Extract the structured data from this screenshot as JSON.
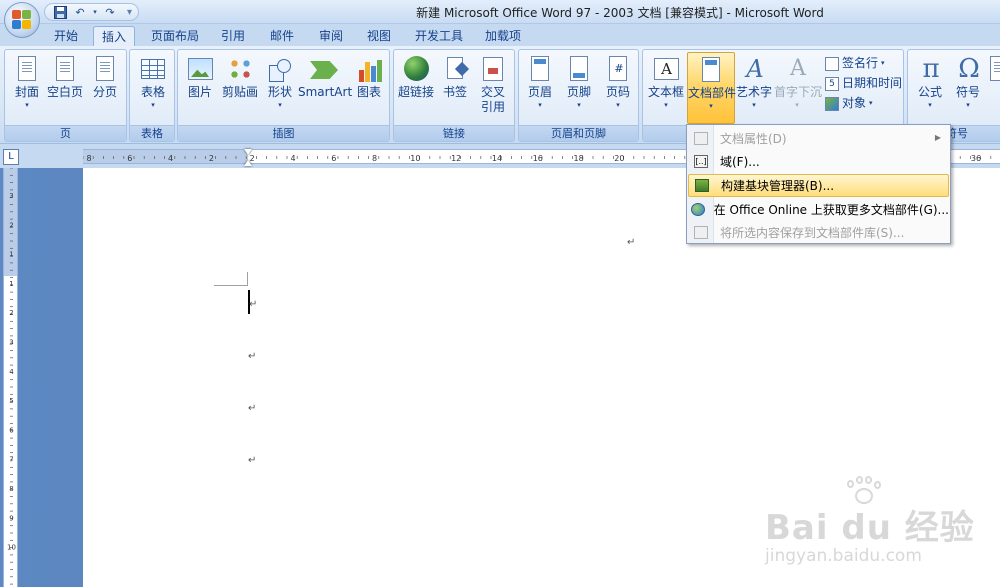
{
  "window": {
    "title": "新建 Microsoft Office Word 97 - 2003 文档 [兼容模式] - Microsoft Word"
  },
  "quick_access": {
    "save_icon": "save-icon",
    "undo_icon": "undo-icon",
    "redo_icon": "redo-icon"
  },
  "tabs": [
    "开始",
    "插入",
    "页面布局",
    "引用",
    "邮件",
    "审阅",
    "视图",
    "开发工具",
    "加载项"
  ],
  "active_tab": "插入",
  "ribbon": {
    "groups": {
      "pages": {
        "label": "页",
        "buttons": [
          "封面",
          "空白页",
          "分页"
        ]
      },
      "tables": {
        "label": "表格",
        "buttons": [
          "表格"
        ]
      },
      "illustrations": {
        "label": "插图",
        "buttons": [
          "图片",
          "剪贴画",
          "形状",
          "SmartArt",
          "图表"
        ]
      },
      "links": {
        "label": "链接",
        "buttons": [
          "超链接",
          "书签",
          "交叉",
          "引用"
        ]
      },
      "header_footer": {
        "label": "页眉和页脚",
        "buttons": [
          "页眉",
          "页脚",
          "页码"
        ]
      },
      "text": {
        "label": "",
        "buttons": [
          "文本框",
          "文档部件",
          "艺术字",
          "首字下沉"
        ],
        "small": [
          "签名行",
          "日期和时间",
          "对象"
        ]
      },
      "symbols": {
        "label": "符号",
        "buttons": [
          "公式",
          "符号"
        ]
      }
    }
  },
  "ruler": {
    "horizontal_labels": [
      "8",
      "6",
      "4",
      "2",
      "2",
      "4",
      "6",
      "8",
      "10",
      "12",
      "14",
      "16",
      "18",
      "20",
      "36"
    ],
    "vertical_labels": [
      "3",
      "2",
      "1",
      "1",
      "2",
      "3",
      "4",
      "5",
      "6",
      "7",
      "8",
      "9",
      "10"
    ]
  },
  "quick_parts_menu": {
    "items": [
      {
        "label": "文档属性(D)",
        "enabled": false,
        "submenu": true,
        "icon": "document-property-icon"
      },
      {
        "label": "域(F)...",
        "enabled": true,
        "submenu": false,
        "icon": "field-icon"
      },
      {
        "label": "构建基块管理器(B)...",
        "enabled": true,
        "submenu": false,
        "highlighted": true,
        "icon": "building-blocks-icon"
      },
      {
        "label": "在 Office Online 上获取更多文档部件(G)...",
        "enabled": true,
        "submenu": false,
        "icon": "office-online-icon"
      },
      {
        "label": "将所选内容保存到文档部件库(S)...",
        "enabled": false,
        "submenu": false,
        "icon": "save-to-gallery-icon"
      }
    ]
  },
  "watermark": {
    "main": "Bai du 经验",
    "sub": "jingyan.baidu.com"
  },
  "colors": {
    "accent": "#15428b",
    "highlight": "#ffd76b",
    "doc_background": "#4d79b6"
  }
}
